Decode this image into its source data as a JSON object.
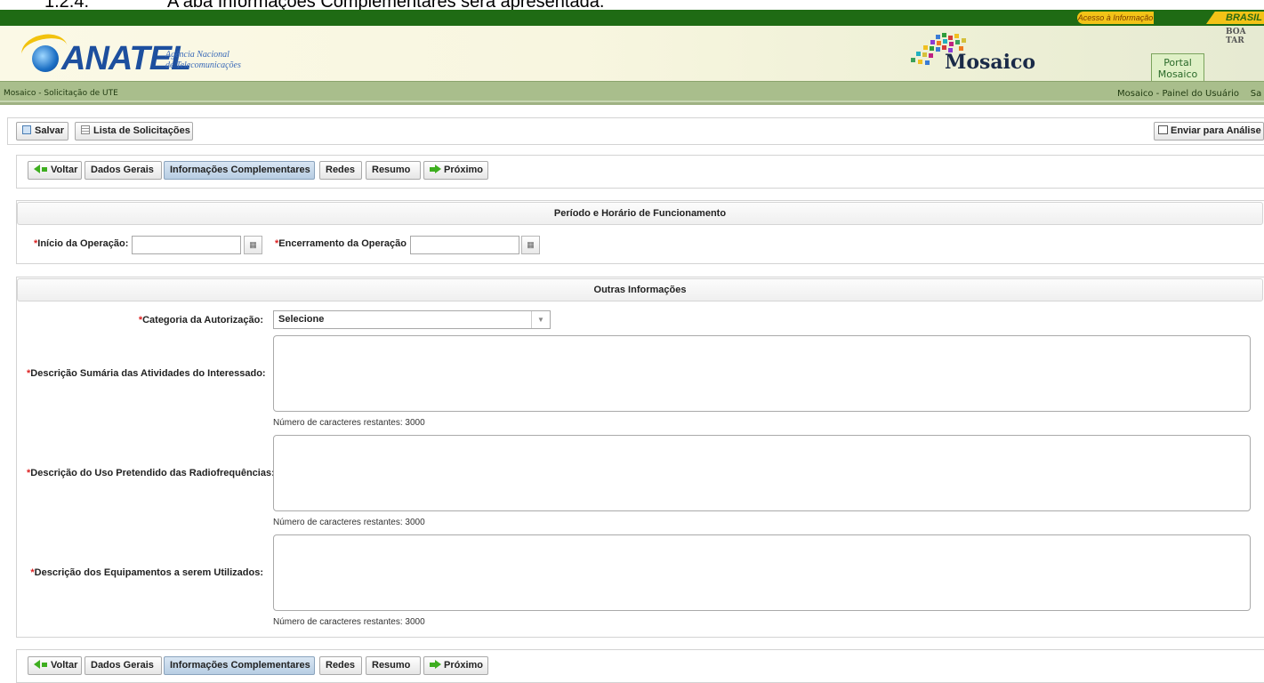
{
  "doc_heading": {
    "number": "1.2.4.",
    "text": "A aba Informações Complementares será apresentada."
  },
  "portal_bar": {
    "acesso": "Acesso à Informação",
    "brasil": "BRASIL",
    "greeting": "BOA TAR"
  },
  "header": {
    "logo_text": "ANATEL",
    "logo_sub_1": "Agência Nacional",
    "logo_sub_2": "de Telecomunicações",
    "mosaico": "Mosaico",
    "portal_tab_1": "Portal",
    "portal_tab_2": "Mosaico"
  },
  "breadcrumb": {
    "left": "Mosaico - Solicitação de UTE",
    "right": "Mosaico - Painel do Usuário",
    "right_cut": "Sa"
  },
  "toolbar": {
    "save": "Salvar",
    "list": "Lista de Solicitações",
    "send": "Enviar para Análise"
  },
  "tabs": {
    "back": "Voltar",
    "general": "Dados Gerais",
    "complementary": "Informações Complementares",
    "networks": "Redes",
    "summary": "Resumo",
    "next": "Próximo"
  },
  "section_period": {
    "title": "Período e Horário de Funcionamento",
    "start_label": "Início da Operação:",
    "end_label": "Encerramento da Operação",
    "start_value": "",
    "end_value": ""
  },
  "section_other": {
    "title": "Outras Informações",
    "category_label": "Categoria da Autorização:",
    "category_value": "Selecione",
    "activities_label": "Descrição Sumária das Atividades do Interessado:",
    "usage_label": "Descrição do Uso Pretendido das Radiofrequências:",
    "equipment_label": "Descrição dos Equipamentos a serem Utilizados:",
    "counter_prefix": "Número de caracteres restantes: 3000"
  },
  "required_mark": "*",
  "colors": {
    "topbar": "#1f6b14",
    "accent_yellow": "#f3c317",
    "active_tab": "#b7cde3",
    "required": "#d22222"
  }
}
